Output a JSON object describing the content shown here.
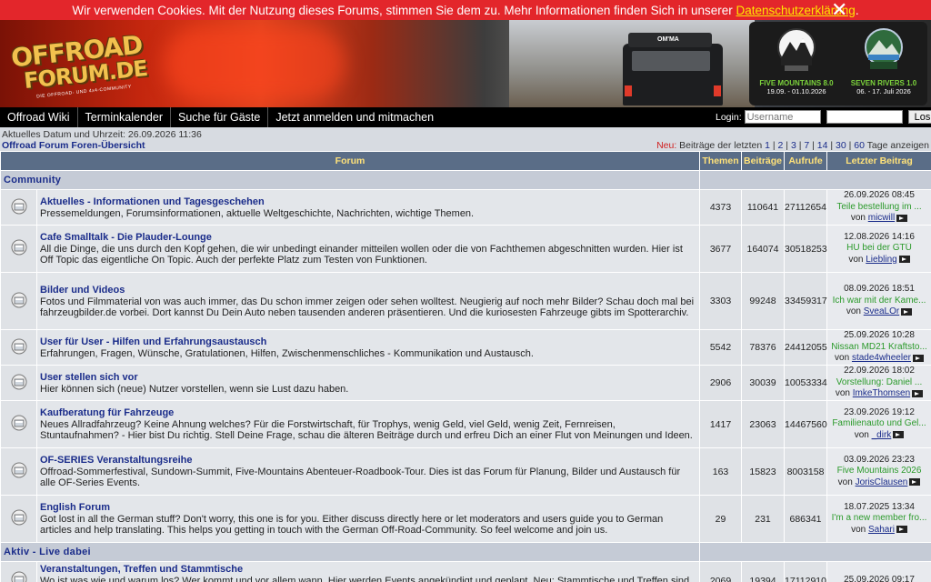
{
  "cookie": {
    "text": "Wir verwenden Cookies. Mit der Nutzung dieses Forums, stimmen Sie dem zu. Mehr Informationen finden Sich in unserer ",
    "link": "Datenschutzerklärung",
    "suffix": ".",
    "close_icon": "✕"
  },
  "banner": {
    "logo_line1": "OFFROAD",
    "logo_line2": "FORUM.DE",
    "logo_sub": "DIE OFFROAD- UND 4x4-COMMUNITY",
    "truck_label": "OM'MA",
    "events": [
      {
        "name": "FIVE MOUNTAINS 8.0",
        "dates": "19.09. - 01.10.2026"
      },
      {
        "name": "SEVEN RIVERS 1.0",
        "dates": "06. - 17. Juli 2026"
      }
    ]
  },
  "nav": {
    "items": [
      "Offroad Wiki",
      "Terminkalender",
      "Suche für Gäste",
      "Jetzt anmelden und mitmachen"
    ],
    "login_label": "Login:",
    "username_placeholder": "Username",
    "password_value": "",
    "login_button": "Los"
  },
  "info": {
    "date": "Aktuelles Datum und Uhrzeit: 26.09.2026 11:36",
    "overview": "Offroad Forum Foren-Übersicht",
    "neu": "Neu:",
    "recent_prefix": " Beiträge der letzten ",
    "recent_links": [
      "1",
      "2",
      "3",
      "7",
      "14",
      "30",
      "60"
    ],
    "recent_suffix": " Tage anzeigen"
  },
  "table": {
    "headers": {
      "forum": "Forum",
      "themen": "Themen",
      "beitraege": "Beiträge",
      "aufrufe": "Aufrufe",
      "letzter": "Letzter Beitrag"
    },
    "categories": [
      {
        "title": "Community",
        "forums": [
          {
            "title": "Aktuelles - Informationen und Tagesgeschehen",
            "desc": "Pressemeldungen, Forumsinformationen, aktuelle Weltgeschichte, Nachrichten, wichtige Themen.",
            "themen": "4373",
            "beitraege": "110641",
            "aufrufe": "27112654",
            "last_date": "26.09.2026 08:45",
            "last_title": "Teile bestellung im ...",
            "last_by": "von ",
            "last_user": "micwill"
          },
          {
            "title": "Cafe Smalltalk - Die Plauder-Lounge",
            "desc": "All die Dinge, die uns durch den Kopf gehen, die wir unbedingt einander mitteilen wollen oder die von Fachthemen abgeschnitten wurden. Hier ist Off Topic das eigentliche On Topic. Auch der perfekte Platz zum Testen von Funktionen.",
            "themen": "3677",
            "beitraege": "164074",
            "aufrufe": "30518253",
            "last_date": "12.08.2026 14:16",
            "last_title": "HU bei der GTÜ",
            "last_by": "von ",
            "last_user": "Liebling"
          },
          {
            "title": "Bilder und Videos",
            "desc": "Fotos und Filmmaterial von was auch immer, das Du schon immer zeigen oder sehen wolltest. Neugierig auf noch mehr Bilder? Schau doch mal bei fahrzeugbilder.de vorbei. Dort kannst Du Dein Auto neben tausenden anderen präsentieren. Und die kuriosesten Fahrzeuge gibts im Spotterarchiv.",
            "themen": "3303",
            "beitraege": "99248",
            "aufrufe": "33459317",
            "last_date": "08.09.2026 18:51",
            "last_title": "Ich war mit der Kame...",
            "last_by": "von ",
            "last_user": "SveaLOr"
          },
          {
            "title": "User für User - Hilfen und Erfahrungsaustausch",
            "desc": "Erfahrungen, Fragen, Wünsche, Gratulationen, Hilfen, Zwischenmenschliches - Kommunikation und Austausch.",
            "themen": "5542",
            "beitraege": "78376",
            "aufrufe": "24412055",
            "last_date": "25.09.2026 10:28",
            "last_title": "Nissan MD21 Kraftsto...",
            "last_by": "von ",
            "last_user": "stade4wheeler"
          },
          {
            "title": "User stellen sich vor",
            "desc": "Hier können sich (neue) Nutzer vorstellen, wenn sie Lust dazu haben.",
            "themen": "2906",
            "beitraege": "30039",
            "aufrufe": "10053334",
            "last_date": "22.09.2026 18:02",
            "last_title": "Vorstellung: Daniel ...",
            "last_by": "von ",
            "last_user": "ImkeThomsen"
          },
          {
            "title": "Kaufberatung für Fahrzeuge",
            "desc": "Neues Allradfahrzeug? Keine Ahnung welches? Für die Forstwirtschaft, für Trophys, wenig Geld, viel Geld, wenig Zeit, Fernreisen, Stuntaufnahmen? - Hier bist Du richtig. Stell Deine Frage, schau die älteren Beiträge durch und erfreu Dich an einer Flut von Meinungen und Ideen.",
            "themen": "1417",
            "beitraege": "23063",
            "aufrufe": "14467560",
            "last_date": "23.09.2026 19:12",
            "last_title": "Familienauto und Gel...",
            "last_by": "von ",
            "last_user": "_dirk"
          },
          {
            "title": "OF-SERIES Veranstaltungsreihe",
            "desc": "Offroad-Sommerfestival, Sundown-Summit, Five-Mountains Abenteuer-Roadbook-Tour. Dies ist das Forum für Planung, Bilder und Austausch für alle OF-Series Events.",
            "themen": "163",
            "beitraege": "15823",
            "aufrufe": "8003158",
            "last_date": "03.09.2026 23:23",
            "last_title": "Five Mountains 2026",
            "last_by": "von ",
            "last_user": "JorisClausen"
          },
          {
            "title": "English Forum",
            "desc": "Got lost in all the German stuff? Don't worry, this one is for you. Either discuss directly here or let moderators and users guide you to German articles and help translating. This helps you getting in touch with the German Off-Road-Community. So feel welcome and join us.",
            "themen": "29",
            "beitraege": "231",
            "aufrufe": "686341",
            "last_date": "18.07.2025 13:34",
            "last_title": "I'm a new member fro...",
            "last_by": "von ",
            "last_user": "Sahari"
          }
        ]
      },
      {
        "title": "Aktiv - Live dabei",
        "forums": [
          {
            "title": "Veranstaltungen, Treffen und Stammtische",
            "desc": "Wo ist was wie und warum los? Wer kommt und vor allem wann. Hier werden Events angekündigt und geplant. Neu: Stammtische und Treffen sind nun",
            "themen": "2069",
            "beitraege": "19394",
            "aufrufe": "17112910",
            "last_date": "25.09.2026 09:17",
            "last_title": "",
            "last_by": "",
            "last_user": ""
          }
        ]
      }
    ]
  },
  "colors": {
    "cookie_bg": "#e3262b",
    "header_bg": "#5a6d87",
    "header_text": "#ffe27a",
    "forum_title": "#1a2c8a",
    "last_title": "#2b9a2b"
  },
  "icons": {
    "forum_icon": "folder-read-icon",
    "jump_icon": "jump-to-post-icon",
    "close_icon": "close-icon"
  }
}
